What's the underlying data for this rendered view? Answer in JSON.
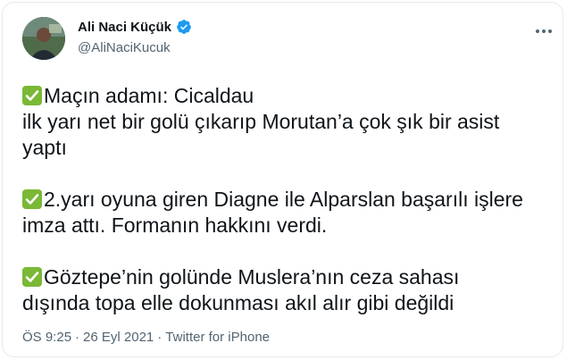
{
  "author": {
    "name": "Ali Naci Küçük",
    "handle": "@AliNaciKucuk",
    "verified": true
  },
  "tweet": {
    "paragraphs": [
      {
        "lines": [
          "Maçın adamı: Cicaldau",
          "ilk yarı net bir golü çıkarıp Morutan’a çok şık bir asist",
          "yaptı"
        ]
      },
      {
        "lines": [
          "2.yarı oyuna giren Diagne ile Alparslan başarılı işlere",
          "imza attı. Formanın hakkını verdi."
        ]
      },
      {
        "lines": [
          "Göztepe’nin golünde Muslera’nın ceza sahası",
          "dışında topa elle dokunması akıl alır gibi değildi"
        ]
      }
    ]
  },
  "meta": {
    "time": "ÖS 9:25",
    "separator": "·",
    "date": "26 Eyl 2021",
    "source": "Twitter for iPhone"
  },
  "icons": {
    "verified": "verified-badge-icon",
    "bullet": "check-mark-icon",
    "more": "more-options-icon"
  },
  "colors": {
    "verified": "#1d9bf0",
    "check_emoji": "#7ab836",
    "secondary_text": "#536471"
  }
}
